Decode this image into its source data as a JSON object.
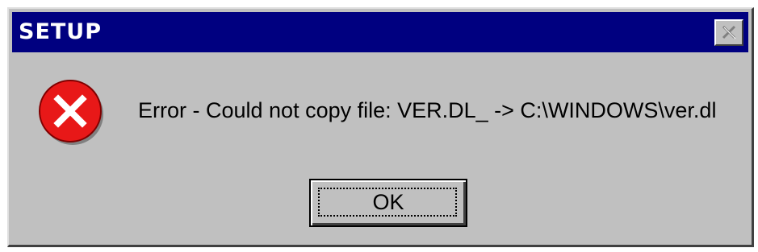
{
  "window": {
    "title": "SETUP",
    "close_icon": "close-icon"
  },
  "dialog": {
    "icon": "error-icon",
    "message": "Error - Could not copy file: VER.DL_ -> C:\\WINDOWS\\ver.dl",
    "ok_label": "OK"
  },
  "colors": {
    "titlebar": "#000080",
    "face": "#c0c0c0",
    "error_red": "#e81818"
  }
}
